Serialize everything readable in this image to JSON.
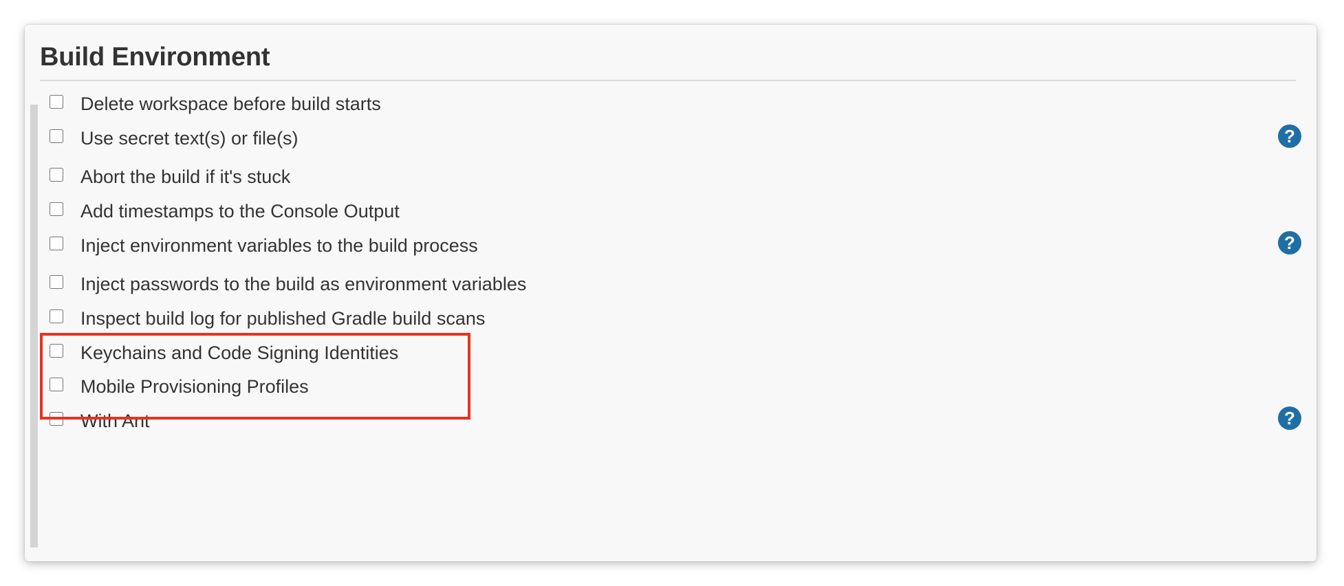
{
  "section": {
    "title": "Build Environment"
  },
  "options": [
    {
      "label": "Delete workspace before build starts",
      "checked": false,
      "has_help": false
    },
    {
      "label": "Use secret text(s) or file(s)",
      "checked": false,
      "has_help": true
    },
    {
      "label": "Abort the build if it's stuck",
      "checked": false,
      "has_help": false
    },
    {
      "label": "Add timestamps to the Console Output",
      "checked": false,
      "has_help": false
    },
    {
      "label": "Inject environment variables to the build process",
      "checked": false,
      "has_help": true
    },
    {
      "label": "Inject passwords to the build as environment variables",
      "checked": false,
      "has_help": false
    },
    {
      "label": "Inspect build log for published Gradle build scans",
      "checked": false,
      "has_help": false
    },
    {
      "label": "Keychains and Code Signing Identities",
      "checked": false,
      "has_help": false
    },
    {
      "label": "Mobile Provisioning Profiles",
      "checked": false,
      "has_help": false
    },
    {
      "label": "With Ant",
      "checked": false,
      "has_help": true
    }
  ],
  "help_icon": {
    "glyph": "?",
    "icon": "help-icon",
    "color": "#1f6fa6"
  },
  "highlight": {
    "color": "#e8321f",
    "covers_options": [
      "Keychains and Code Signing Identities",
      "Mobile Provisioning Profiles"
    ]
  }
}
